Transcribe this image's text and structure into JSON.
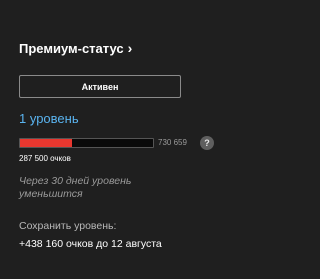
{
  "premium": {
    "title": "Премиум-статус",
    "chevron": "›",
    "status_label": "Активен",
    "level_label": "1 уровень",
    "progress": {
      "current": 287500,
      "goal": 730659,
      "current_label": "287 500 очков",
      "goal_label": "730 659",
      "fill_color": "#e8372f"
    },
    "help_icon": "?",
    "hint": "Через 30 дней уровень уменьшится",
    "keep_level_label": "Сохранить уровень:",
    "keep_level_value": "+438 160 очков до 12 августа"
  },
  "colors": {
    "background": "#1f1f1f",
    "accent_link": "#5ab4f0",
    "progress_fill": "#e8372f"
  }
}
